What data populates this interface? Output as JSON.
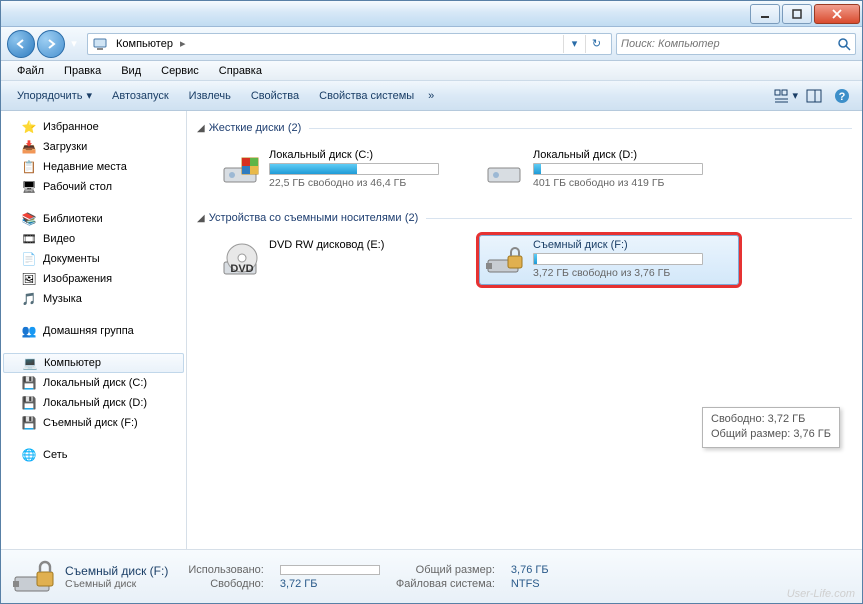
{
  "titlebar": {
    "min": "_",
    "max": "□",
    "close": "✕"
  },
  "address": {
    "location": "Компьютер",
    "arrow": "▸"
  },
  "search": {
    "placeholder": "Поиск: Компьютер"
  },
  "menubar": [
    "Файл",
    "Правка",
    "Вид",
    "Сервис",
    "Справка"
  ],
  "toolbar": {
    "organize": "Упорядочить",
    "autoplay": "Автозапуск",
    "eject": "Извлечь",
    "properties": "Свойства",
    "sysprops": "Свойства системы",
    "more": "»"
  },
  "sidebar": {
    "favorites": {
      "header": "Избранное",
      "items": [
        "Загрузки",
        "Недавние места",
        "Рабочий стол"
      ]
    },
    "libraries": {
      "header": "Библиотеки",
      "items": [
        "Видео",
        "Документы",
        "Изображения",
        "Музыка"
      ]
    },
    "homegroup": "Домашняя группа",
    "computer": {
      "header": "Компьютер",
      "items": [
        "Локальный диск (C:)",
        "Локальный диск (D:)",
        "Съемный диск (F:)"
      ]
    },
    "network": "Сеть"
  },
  "groups": {
    "hdd": {
      "title": "Жесткие диски",
      "count": "(2)"
    },
    "removable": {
      "title": "Устройства со съемными носителями",
      "count": "(2)"
    }
  },
  "drives": {
    "c": {
      "name": "Локальный диск (C:)",
      "free": "22,5 ГБ свободно из 46,4 ГБ",
      "pct": 52
    },
    "d": {
      "name": "Локальный диск (D:)",
      "free": "401 ГБ свободно из 419 ГБ",
      "pct": 4
    },
    "dvd": {
      "name": "DVD RW дисковод (E:)"
    },
    "f": {
      "name": "Съемный диск (F:)",
      "free": "3,72 ГБ свободно из 3,76 ГБ",
      "pct": 2
    }
  },
  "tooltip": {
    "line1": "Свободно: 3,72 ГБ",
    "line2": "Общий размер: 3,76 ГБ"
  },
  "details": {
    "title": "Съемный диск (F:)",
    "sub": "Съемный диск",
    "used_lbl": "Использовано:",
    "free_lbl": "Свободно:",
    "free_val": "3,72 ГБ",
    "total_lbl": "Общий размер:",
    "total_val": "3,76 ГБ",
    "fs_lbl": "Файловая система:",
    "fs_val": "NTFS"
  },
  "watermark": "User-Life.com"
}
